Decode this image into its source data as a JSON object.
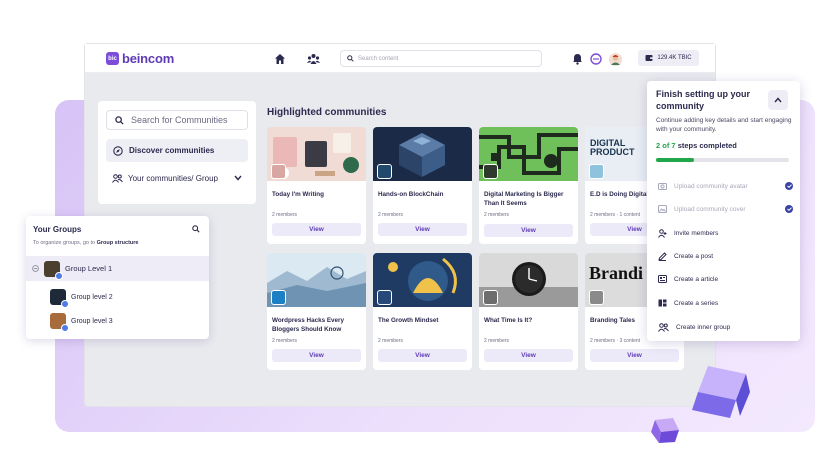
{
  "brand": {
    "name": "beincom",
    "mark": "bic"
  },
  "topbar": {
    "search_placeholder": "Search content",
    "tbc_balance": "129.4K TBIC"
  },
  "left_panel": {
    "search_placeholder": "Search for Communities",
    "discover_label": "Discover communities",
    "your_communities_label": "Your communities/ Group"
  },
  "highlighted": {
    "title": "Highlighted communities",
    "cards": [
      {
        "name": "Today I'm Writing",
        "members": "2 members",
        "view": "View"
      },
      {
        "name": "Hands-on BlockChain",
        "members": "2 members",
        "view": "View"
      },
      {
        "name": "Digital Marketing Is Bigger Than It Seems",
        "members": "2 members",
        "view": "View"
      },
      {
        "name": "E.D is Doing Digital",
        "members": "2 members · 1 content",
        "view": "View",
        "banner_text": "DIGITAL PRODUCT"
      },
      {
        "name": "Wordpress Hacks Every Bloggers Should Know",
        "members": "2 members",
        "view": "View"
      },
      {
        "name": "The Growth Mindset",
        "members": "2 members",
        "view": "View"
      },
      {
        "name": "What Time Is It?",
        "members": "2 members",
        "view": "View"
      },
      {
        "name": "Branding Tales",
        "members": "2 members · 3 content",
        "view": "View",
        "banner_text": "Brandi"
      }
    ]
  },
  "groups_panel": {
    "title": "Your Groups",
    "subtitle_prefix": "To organize groups, go to",
    "subtitle_link": "Group structure",
    "level1": "Group Level 1",
    "level2": "Group level 2",
    "level3": "Group level 3"
  },
  "setup": {
    "title": "Finish setting up your community",
    "description": "Continue adding key details and start engaging with your community.",
    "steps_done": "2 of 7",
    "steps_suffix": "steps completed",
    "progress": 0.2857,
    "tasks": [
      {
        "label": "Upload community avatar",
        "done": true
      },
      {
        "label": "Upload community cover",
        "done": true
      },
      {
        "label": "Invite members",
        "done": false
      },
      {
        "label": "Create a post",
        "done": false
      },
      {
        "label": "Create a article",
        "done": false
      },
      {
        "label": "Create a series",
        "done": false
      },
      {
        "label": "Create inner group",
        "done": false
      }
    ]
  },
  "colors": {
    "brand": "#7d4cdb",
    "progress": "#22a64a",
    "check": "#3a43a6"
  }
}
